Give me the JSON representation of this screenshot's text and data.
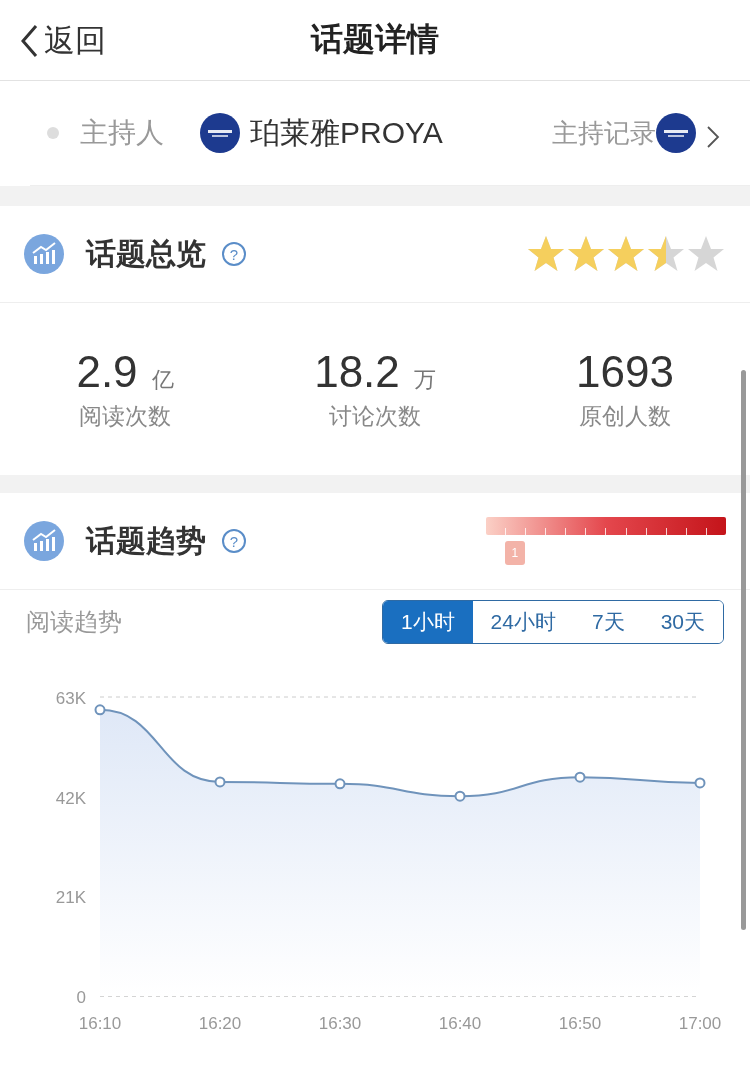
{
  "nav": {
    "back": "返回",
    "title": "话题详情"
  },
  "host": {
    "label": "主持人",
    "name": "珀莱雅PROYA",
    "record": "主持记录"
  },
  "overview": {
    "title": "话题总览",
    "help": "?",
    "stars": 3.5,
    "stats": [
      {
        "value": "2.9",
        "unit": "亿",
        "label": "阅读次数"
      },
      {
        "value": "18.2",
        "unit": "万",
        "label": "讨论次数"
      },
      {
        "value": "1693",
        "label": "原创人数"
      }
    ]
  },
  "trend": {
    "title": "话题趋势",
    "help": "?",
    "heat": {
      "marker": "1"
    },
    "subtitle": "阅读趋势",
    "tabs": [
      {
        "label": "1小时",
        "selected": true
      },
      {
        "label": "24小时",
        "selected": false
      },
      {
        "label": "7天",
        "selected": false
      },
      {
        "label": "30天",
        "selected": false
      }
    ],
    "chart_data": {
      "type": "area",
      "categories": [
        "16:10",
        "16:20",
        "16:30",
        "16:40",
        "16:50",
        "17:00"
      ],
      "series": [
        {
          "color": "#6f93bb",
          "values": [
            60300,
            45100,
            44700,
            42100,
            46100,
            44900
          ]
        }
      ],
      "ylim": [
        0,
        63000
      ],
      "yticks": [
        {
          "value": 0,
          "label": "0"
        },
        {
          "value": 21000,
          "label": "21K"
        },
        {
          "value": 42000,
          "label": "42K"
        },
        {
          "value": 63000,
          "label": "63K"
        }
      ]
    }
  }
}
